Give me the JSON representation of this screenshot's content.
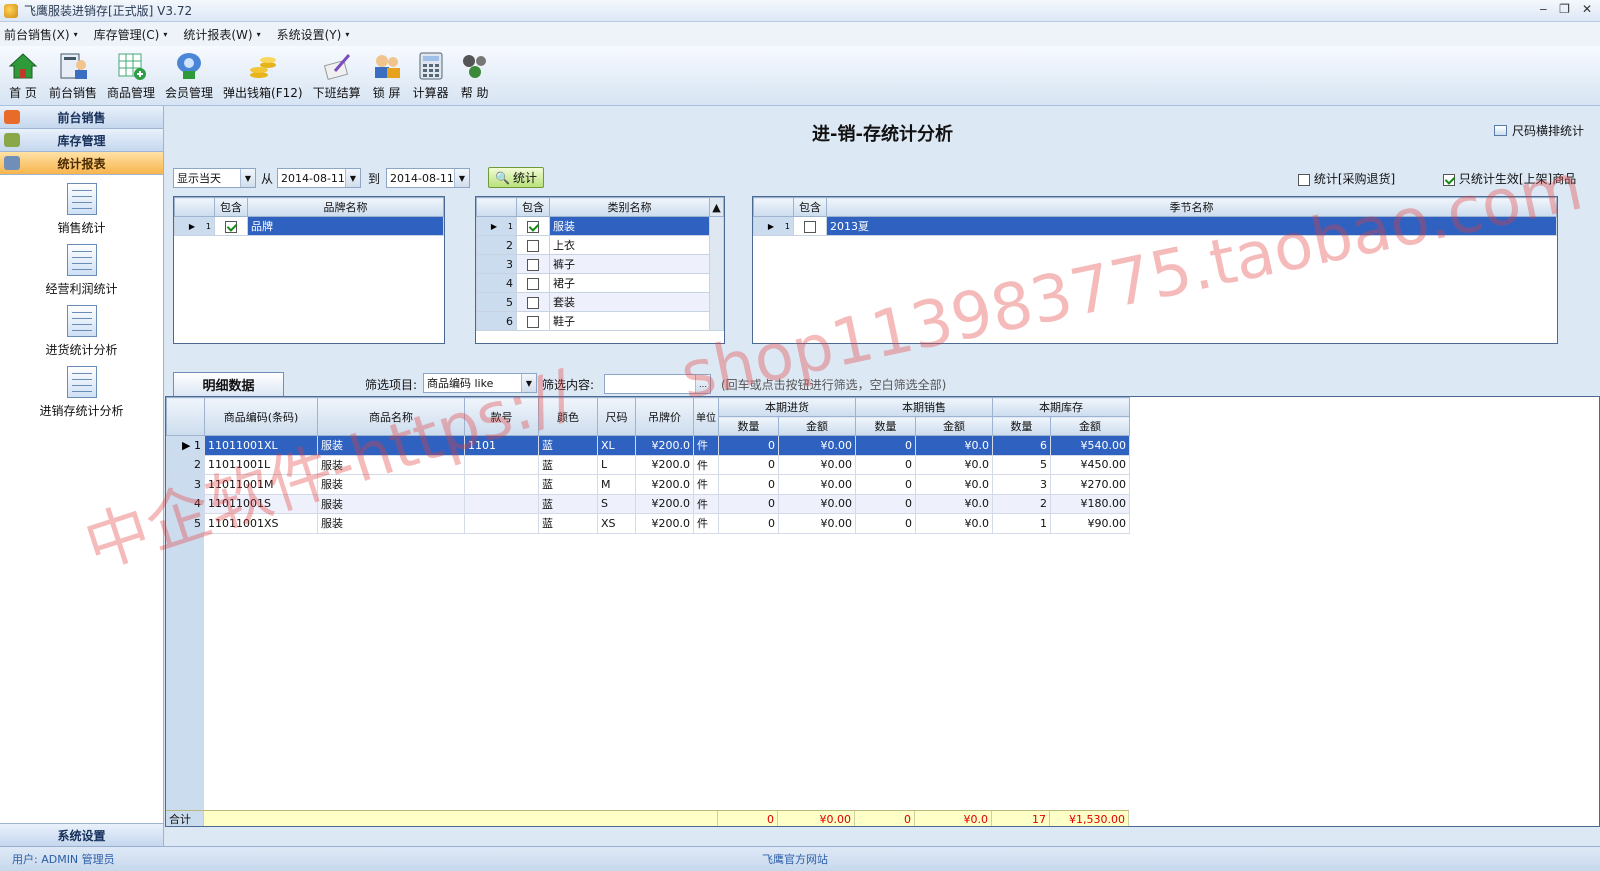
{
  "window": {
    "title": "飞鹰服装进销存[正式版] V3.72",
    "controls": [
      "‒",
      "❐",
      "✕"
    ]
  },
  "menu": [
    "前台销售(X)",
    "库存管理(C)",
    "统计报表(W)",
    "系统设置(Y)"
  ],
  "toolbar": [
    {
      "label": "首 页",
      "icon": "home-icon"
    },
    {
      "label": "前台销售",
      "icon": "pos-icon"
    },
    {
      "label": "商品管理",
      "icon": "goods-icon"
    },
    {
      "label": "会员管理",
      "icon": "member-icon"
    },
    {
      "label": "弹出钱箱(F12)",
      "icon": "cash-icon"
    },
    {
      "label": "下班结算",
      "icon": "settle-icon"
    },
    {
      "label": "锁 屏",
      "icon": "lock-icon"
    },
    {
      "label": "计算器",
      "icon": "calculator-icon"
    },
    {
      "label": "帮 助",
      "icon": "help-icon"
    }
  ],
  "sidebar": {
    "sections": [
      "前台销售",
      "库存管理",
      "统计报表"
    ],
    "active": "统计报表",
    "items": [
      "销售统计",
      "经营利润统计",
      "进货统计分析",
      "进销存统计分析"
    ],
    "footer": "系统设置"
  },
  "page": {
    "title": "进-销-存统计分析",
    "size_stat": "尺码横排统计"
  },
  "filters": {
    "period": "显示当天",
    "from_label": "从",
    "from": "2014-08-11",
    "to_label": "到",
    "to": "2014-08-11",
    "stat_button": "统计",
    "return_label": "统计[采购退货]",
    "return_checked": false,
    "only_active_label": "只统计生效[上架]商品",
    "only_active_checked": true
  },
  "brand_grid": {
    "headers": [
      "包含",
      "品牌名称"
    ],
    "rows": [
      {
        "n": "1",
        "checked": true,
        "name": "品牌"
      }
    ]
  },
  "category_grid": {
    "headers": [
      "包含",
      "类别名称"
    ],
    "rows": [
      {
        "n": "1",
        "checked": true,
        "name": "服装"
      },
      {
        "n": "2",
        "checked": false,
        "name": "上衣"
      },
      {
        "n": "3",
        "checked": false,
        "name": "裤子"
      },
      {
        "n": "4",
        "checked": false,
        "name": "裙子"
      },
      {
        "n": "5",
        "checked": false,
        "name": "套装"
      },
      {
        "n": "6",
        "checked": false,
        "name": "鞋子"
      }
    ]
  },
  "season_grid": {
    "headers": [
      "包含",
      "季节名称"
    ],
    "rows": [
      {
        "n": "1",
        "checked": false,
        "name": "2013夏"
      }
    ]
  },
  "detail": {
    "tab": "明细数据",
    "filter_label": "筛选项目:",
    "filter_value": "商品编码 like",
    "content_label": "筛选内容:",
    "content_value": "",
    "hint": "(回车或点击按钮进行筛选，空白筛选全部)",
    "headers": {
      "code": "商品编码(条码)",
      "name": "商品名称",
      "style": "款号",
      "color": "颜色",
      "size": "尺码",
      "price": "吊牌价",
      "unit": "单位",
      "in": "本期进货",
      "sale": "本期销售",
      "stock": "本期库存",
      "qty": "数量",
      "amt": "金额"
    },
    "rows": [
      {
        "n": "1",
        "code": "11011001XL",
        "name": "服装",
        "style": "1101",
        "color": "蓝",
        "size": "XL",
        "price": "¥200.0",
        "unit": "件",
        "in_q": "0",
        "in_a": "¥0.00",
        "s_q": "0",
        "s_a": "¥0.0",
        "st_q": "6",
        "st_a": "¥540.00"
      },
      {
        "n": "2",
        "code": "11011001L",
        "name": "服装",
        "style": "",
        "color": "蓝",
        "size": "L",
        "price": "¥200.0",
        "unit": "件",
        "in_q": "0",
        "in_a": "¥0.00",
        "s_q": "0",
        "s_a": "¥0.0",
        "st_q": "5",
        "st_a": "¥450.00"
      },
      {
        "n": "3",
        "code": "11011001M",
        "name": "服装",
        "style": "",
        "color": "蓝",
        "size": "M",
        "price": "¥200.0",
        "unit": "件",
        "in_q": "0",
        "in_a": "¥0.00",
        "s_q": "0",
        "s_a": "¥0.0",
        "st_q": "3",
        "st_a": "¥270.00"
      },
      {
        "n": "4",
        "code": "11011001S",
        "name": "服装",
        "style": "",
        "color": "蓝",
        "size": "S",
        "price": "¥200.0",
        "unit": "件",
        "in_q": "0",
        "in_a": "¥0.00",
        "s_q": "0",
        "s_a": "¥0.0",
        "st_q": "2",
        "st_a": "¥180.00"
      },
      {
        "n": "5",
        "code": "11011001XS",
        "name": "服装",
        "style": "",
        "color": "蓝",
        "size": "XS",
        "price": "¥200.0",
        "unit": "件",
        "in_q": "0",
        "in_a": "¥0.00",
        "s_q": "0",
        "s_a": "¥0.0",
        "st_q": "1",
        "st_a": "¥90.00"
      }
    ],
    "total": {
      "label": "合计",
      "in_q": "0",
      "in_a": "¥0.00",
      "s_q": "0",
      "s_a": "¥0.0",
      "st_q": "17",
      "st_a": "¥1,530.00"
    }
  },
  "status": {
    "user": "用户: ADMIN 管理员",
    "site": "飞鹰官方网站"
  },
  "watermark": {
    "line1": "shop113983775.taobao.com",
    "line2": "中企软件-https://"
  },
  "colors": {
    "selected_row": "#2f62c0",
    "total_text": "#e00000",
    "active_section": "#f7b44c"
  }
}
